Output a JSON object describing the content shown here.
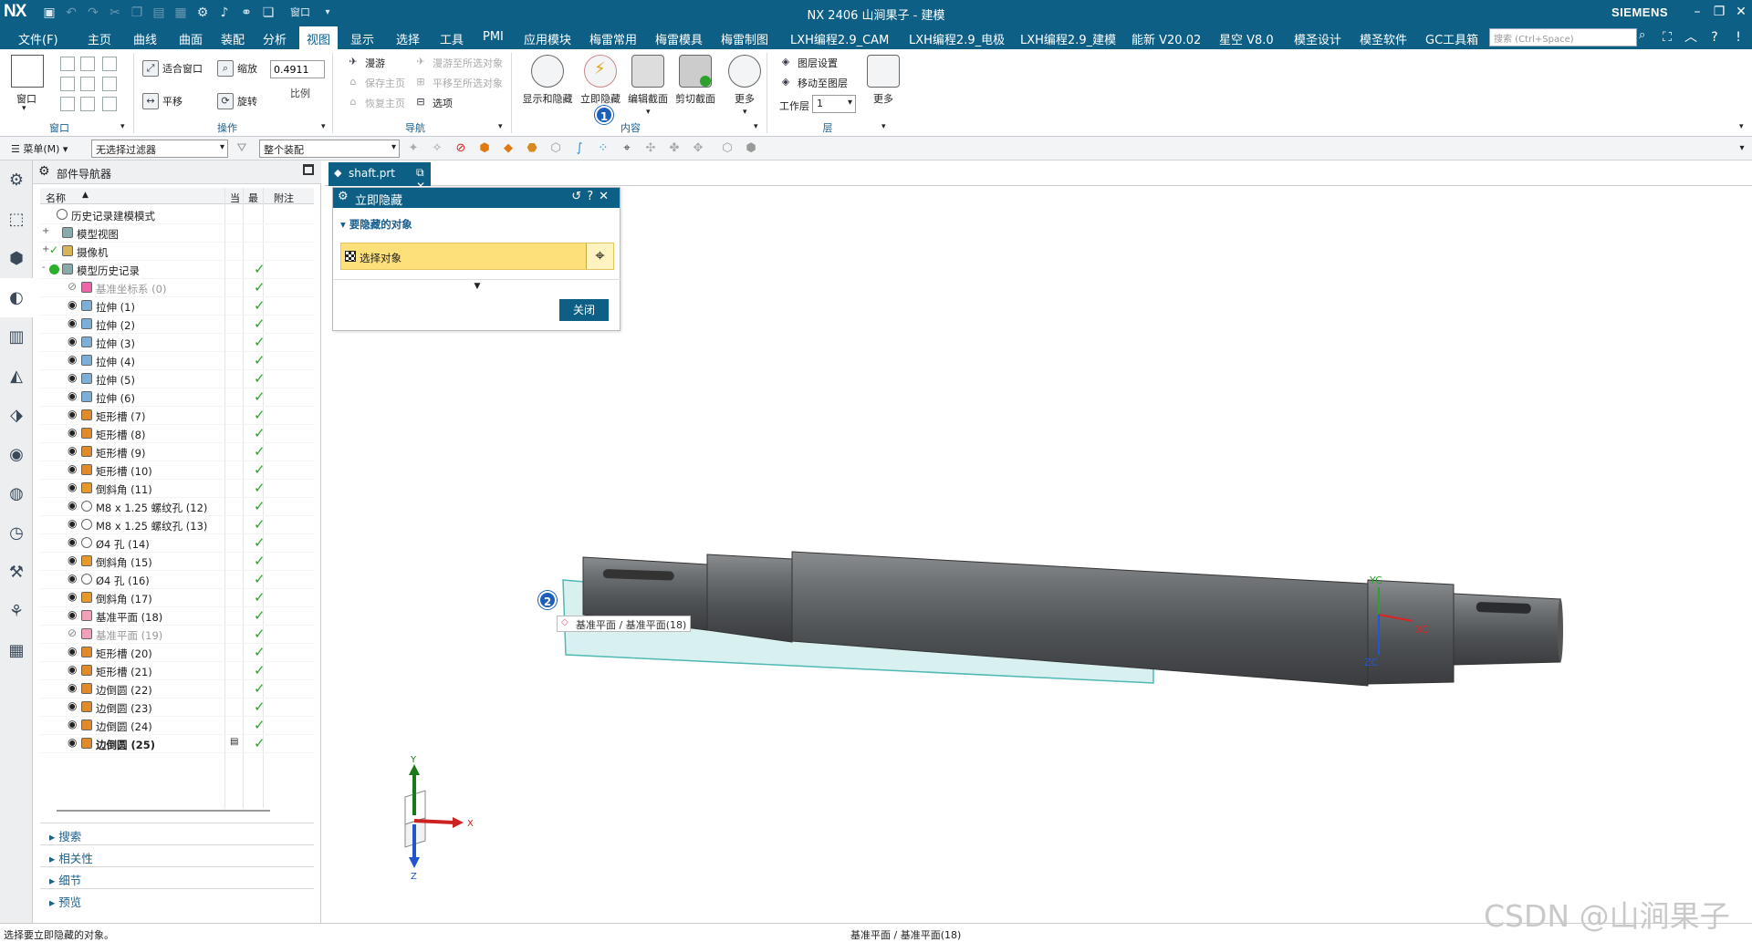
{
  "titlebar": {
    "logo": "NX",
    "title": "NX 2406 山涧果子 - 建模",
    "brand": "SIEMENS",
    "window_menu": "窗口"
  },
  "menu": {
    "items": [
      "文件(F)",
      "主页",
      "曲线",
      "曲面",
      "装配",
      "分析",
      "视图",
      "显示",
      "选择",
      "工具",
      "PMI",
      "应用模块",
      "梅雷常用",
      "梅雷模具",
      "梅雷制图",
      "LXH编程2.9_CAM",
      "LXH编程2.9_电极",
      "LXH编程2.9_建模",
      "能新 V20.02",
      "星空 V8.0",
      "模圣设计",
      "模圣软件",
      "GC工具箱"
    ],
    "active": "视图",
    "search_placeholder": "搜索 (Ctrl+Space)"
  },
  "ribbon": {
    "window_group": {
      "label": "窗口",
      "btn": "窗口"
    },
    "ops_group": {
      "label": "操作",
      "fit": "适合窗口",
      "zoom": "缩放",
      "zoom_value": "0.4911",
      "pan": "平移",
      "rotate": "旋转",
      "scale": "比例"
    },
    "nav_group": {
      "label": "导航",
      "roam": "漫游",
      "save_home": "保存主页",
      "restore_home": "恢复主页",
      "roam_to": "漫游至所选对象",
      "pan_to": "平移至所选对象",
      "options": "选项"
    },
    "content_group": {
      "label": "内容",
      "show_hide": "显示和隐藏",
      "instant_hide": "立即隐藏",
      "edit_section": "编辑截面",
      "clip_section": "剪切截面",
      "more": "更多"
    },
    "layer_group": {
      "label": "层",
      "layer_settings": "图层设置",
      "move_to_layer": "移动至图层",
      "work_layer": "工作层",
      "work_layer_value": "1",
      "more": "更多"
    }
  },
  "toolbar2": {
    "menu": "菜单(M)",
    "filter": "无选择过滤器",
    "scope": "整个装配"
  },
  "navigator": {
    "title": "部件导航器",
    "columns": {
      "name": "名称",
      "current": "当",
      "latest": "最",
      "comment": "附注"
    },
    "rows": [
      {
        "label": "历史记录建模模式",
        "indent": 0,
        "exp": "",
        "icon": "clock",
        "check": false,
        "style": ""
      },
      {
        "label": "模型视图",
        "indent": 0,
        "exp": "+",
        "icon": "view",
        "check": false,
        "style": ""
      },
      {
        "label": "摄像机",
        "indent": 0,
        "exp": "+",
        "icon": "camera",
        "check": false,
        "style": "",
        "tick": true
      },
      {
        "label": "模型历史记录",
        "indent": 0,
        "exp": "-",
        "icon": "history",
        "check": true,
        "style": "",
        "green": true
      },
      {
        "label": "基准坐标系 (0)",
        "indent": 1,
        "exp": "",
        "icon": "csys",
        "check": true,
        "style": "gray",
        "hidden": true
      },
      {
        "label": "拉伸 (1)",
        "indent": 1,
        "exp": "",
        "icon": "extrude",
        "check": true,
        "style": ""
      },
      {
        "label": "拉伸 (2)",
        "indent": 1,
        "exp": "",
        "icon": "extrude",
        "check": true,
        "style": ""
      },
      {
        "label": "拉伸 (3)",
        "indent": 1,
        "exp": "",
        "icon": "extrude",
        "check": true,
        "style": ""
      },
      {
        "label": "拉伸 (4)",
        "indent": 1,
        "exp": "",
        "icon": "extrude",
        "check": true,
        "style": ""
      },
      {
        "label": "拉伸 (5)",
        "indent": 1,
        "exp": "",
        "icon": "extrude",
        "check": true,
        "style": ""
      },
      {
        "label": "拉伸 (6)",
        "indent": 1,
        "exp": "",
        "icon": "extrude",
        "check": true,
        "style": ""
      },
      {
        "label": "矩形槽 (7)",
        "indent": 1,
        "exp": "",
        "icon": "groove",
        "check": true,
        "style": ""
      },
      {
        "label": "矩形槽 (8)",
        "indent": 1,
        "exp": "",
        "icon": "groove",
        "check": true,
        "style": ""
      },
      {
        "label": "矩形槽 (9)",
        "indent": 1,
        "exp": "",
        "icon": "groove",
        "check": true,
        "style": ""
      },
      {
        "label": "矩形槽 (10)",
        "indent": 1,
        "exp": "",
        "icon": "groove",
        "check": true,
        "style": ""
      },
      {
        "label": "倒斜角 (11)",
        "indent": 1,
        "exp": "",
        "icon": "chamfer",
        "check": true,
        "style": ""
      },
      {
        "label": "M8 x 1.25 螺纹孔 (12)",
        "indent": 1,
        "exp": "",
        "icon": "hole",
        "check": true,
        "style": ""
      },
      {
        "label": "M8 x 1.25 螺纹孔 (13)",
        "indent": 1,
        "exp": "",
        "icon": "hole",
        "check": true,
        "style": ""
      },
      {
        "label": "Ø4 孔 (14)",
        "indent": 1,
        "exp": "",
        "icon": "hole",
        "check": true,
        "style": ""
      },
      {
        "label": "倒斜角 (15)",
        "indent": 1,
        "exp": "",
        "icon": "chamfer",
        "check": true,
        "style": ""
      },
      {
        "label": "Ø4 孔 (16)",
        "indent": 1,
        "exp": "",
        "icon": "hole",
        "check": true,
        "style": ""
      },
      {
        "label": "倒斜角 (17)",
        "indent": 1,
        "exp": "",
        "icon": "chamfer",
        "check": true,
        "style": ""
      },
      {
        "label": "基准平面 (18)",
        "indent": 1,
        "exp": "",
        "icon": "plane",
        "check": true,
        "style": ""
      },
      {
        "label": "基准平面 (19)",
        "indent": 1,
        "exp": "",
        "icon": "plane",
        "check": true,
        "style": "gray",
        "hidden": true
      },
      {
        "label": "矩形槽 (20)",
        "indent": 1,
        "exp": "",
        "icon": "groove",
        "check": true,
        "style": ""
      },
      {
        "label": "矩形槽 (21)",
        "indent": 1,
        "exp": "",
        "icon": "groove",
        "check": true,
        "style": ""
      },
      {
        "label": "边倒圆 (22)",
        "indent": 1,
        "exp": "",
        "icon": "blend",
        "check": true,
        "style": ""
      },
      {
        "label": "边倒圆 (23)",
        "indent": 1,
        "exp": "",
        "icon": "blend",
        "check": true,
        "style": ""
      },
      {
        "label": "边倒圆 (24)",
        "indent": 1,
        "exp": "",
        "icon": "blend",
        "check": true,
        "style": ""
      },
      {
        "label": "边倒圆 (25)",
        "indent": 1,
        "exp": "",
        "icon": "blend",
        "check": true,
        "style": "bold",
        "current": true
      }
    ],
    "sections": [
      "搜索",
      "相关性",
      "细节",
      "预览"
    ]
  },
  "tab": {
    "label": "shaft.prt"
  },
  "dialog": {
    "title": "立即隐藏",
    "section": "要隐藏的对象",
    "select": "选择对象",
    "close": "关闭"
  },
  "viewport": {
    "tooltip": "基准平面 / 基准平面(18)",
    "wcs_y": "YC",
    "wcs_x": "XC",
    "wcs_z": "ZC",
    "triad_y": "Y",
    "triad_x": "X",
    "triad_z": "Z",
    "badge1": "1",
    "badge2": "2"
  },
  "status": {
    "left": "选择要立即隐藏的对象。",
    "center": "基准平面 / 基准平面(18)"
  },
  "watermark": "CSDN @山涧果子",
  "colors": {
    "accent": "#0d5f86",
    "highlight": "#fde07a",
    "check": "#2da02d",
    "badge": "#1d5fb8"
  }
}
